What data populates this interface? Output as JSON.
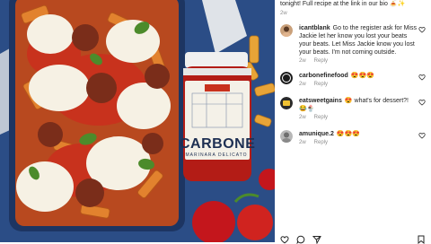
{
  "caption": {
    "text": "tonight! Full recipe at the link in our bio 🍝✨",
    "time": "2w"
  },
  "comments": [
    {
      "username": "icantblank",
      "text": "Go to the register ask for Miss Jackie let her know you lost your beats your beats. Let Miss Jackie know you lost your beats. I'm not coming outside.",
      "time": "2w",
      "reply": "Reply"
    },
    {
      "username": "carbonefinefood",
      "text": "😍😍😍",
      "time": "2w",
      "reply": "Reply"
    },
    {
      "username": "eatsweetgains",
      "text": "😍 what's for dessert?! 😂🍨",
      "time": "2w",
      "reply": "Reply"
    },
    {
      "username": "amunique.2",
      "text": "😍😍😍",
      "time": "2w",
      "reply": "Reply"
    }
  ],
  "photo": {
    "jar_brand": "CARBONE",
    "jar_subtitle": "MARINARA DELICATO"
  },
  "icons": [
    "heart-icon",
    "comment-icon",
    "share-icon",
    "bookmark-icon"
  ],
  "colors": {
    "background_blue": "#2b4d86",
    "sauce_red": "#c8321d",
    "muted_text": "#8e8e8e"
  }
}
